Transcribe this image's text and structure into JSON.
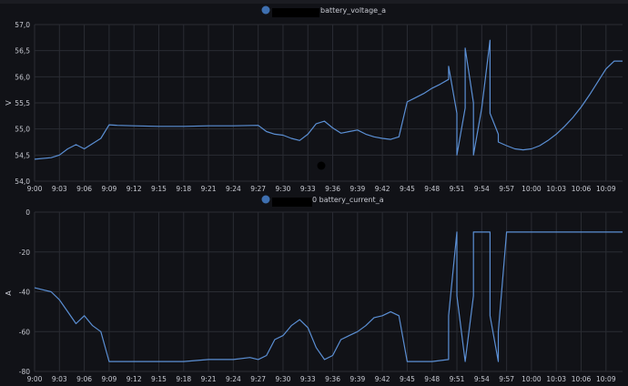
{
  "colors": {
    "background": "#111217",
    "grid": "#2a2c33",
    "text": "#c7c9d1",
    "series": "#5b8fd4",
    "legend_dot": "#3e6fb0",
    "redaction": "#000000"
  },
  "chart_data": [
    {
      "type": "line",
      "legend": {
        "prefix": "",
        "suffix": "battery_voltage_a",
        "placement": "top-center"
      },
      "ylabel": "V",
      "ylim": [
        54.0,
        57.0
      ],
      "y_ticks": [
        "54,0",
        "54,5",
        "55,0",
        "55,5",
        "56,0",
        "56,5",
        "57,0"
      ],
      "y_tick_values": [
        54.0,
        54.5,
        55.0,
        55.5,
        56.0,
        56.5,
        57.0
      ],
      "x_ticks": [
        "9:00",
        "9:03",
        "9:06",
        "9:09",
        "9:12",
        "9:15",
        "9:18",
        "9:21",
        "9:24",
        "9:27",
        "9:30",
        "9:33",
        "9:36",
        "9:39",
        "9:42",
        "9:45",
        "9:48",
        "9:51",
        "9:54",
        "9:57",
        "10:00",
        "10:03",
        "10:06",
        "10:09"
      ],
      "grid": true,
      "series": [
        {
          "x": [
            "9:00",
            "9:02",
            "9:03",
            "9:04",
            "9:05",
            "9:06",
            "9:07",
            "9:08",
            "9:09",
            "9:10",
            "9:12",
            "9:15",
            "9:18",
            "9:21",
            "9:24",
            "9:27",
            "9:28",
            "9:29",
            "9:30",
            "9:31",
            "9:32",
            "9:33",
            "9:34",
            "9:35",
            "9:36",
            "9:37",
            "9:38",
            "9:39",
            "9:40",
            "9:41",
            "9:42",
            "9:43",
            "9:44",
            "9:45",
            "9:46",
            "9:47",
            "9:48",
            "9:49",
            "9:50",
            "9:50",
            "9:51",
            "9:51",
            "9:52",
            "9:52",
            "9:53",
            "9:53",
            "9:54",
            "9:55",
            "9:55",
            "9:56",
            "9:56",
            "9:57",
            "9:58",
            "9:59",
            "10:00",
            "10:01",
            "10:02",
            "10:03",
            "10:04",
            "10:05",
            "10:06",
            "10:07",
            "10:08",
            "10:09",
            "10:10",
            "10:11"
          ],
          "y": [
            54.42,
            54.45,
            54.5,
            54.62,
            54.7,
            54.62,
            54.72,
            54.82,
            55.08,
            55.07,
            55.06,
            55.05,
            55.05,
            55.06,
            55.06,
            55.07,
            54.95,
            54.9,
            54.88,
            54.82,
            54.78,
            54.9,
            55.1,
            55.15,
            55.02,
            54.92,
            54.95,
            54.98,
            54.9,
            54.85,
            54.82,
            54.8,
            54.85,
            55.52,
            55.6,
            55.68,
            55.78,
            55.86,
            55.95,
            56.2,
            55.3,
            54.5,
            55.4,
            56.55,
            55.5,
            54.5,
            55.4,
            56.7,
            55.3,
            54.9,
            54.75,
            54.68,
            54.62,
            54.6,
            54.62,
            54.68,
            54.78,
            54.9,
            55.05,
            55.22,
            55.42,
            55.65,
            55.9,
            56.15,
            56.3,
            56.3
          ]
        }
      ],
      "annotations": []
    },
    {
      "type": "line",
      "legend": {
        "prefix": "",
        "suffix": "0 battery_current_a",
        "placement": "top-center"
      },
      "ylabel": "A",
      "ylim": [
        -80,
        0
      ],
      "y_ticks": [
        "-80",
        "-60",
        "-40",
        "-20",
        "0"
      ],
      "y_tick_values": [
        -80,
        -60,
        -40,
        -20,
        0
      ],
      "x_ticks": [
        "9:00",
        "9:03",
        "9:06",
        "9:09",
        "9:12",
        "9:15",
        "9:18",
        "9:21",
        "9:24",
        "9:27",
        "9:30",
        "9:33",
        "9:36",
        "9:39",
        "9:42",
        "9:45",
        "9:48",
        "9:51",
        "9:54",
        "9:57",
        "10:00",
        "10:03",
        "10:06",
        "10:09"
      ],
      "grid": true,
      "series": [
        {
          "x": [
            "9:00",
            "9:01",
            "9:02",
            "9:03",
            "9:04",
            "9:05",
            "9:06",
            "9:07",
            "9:08",
            "9:09",
            "9:10",
            "9:12",
            "9:15",
            "9:18",
            "9:21",
            "9:24",
            "9:26",
            "9:27",
            "9:28",
            "9:29",
            "9:30",
            "9:31",
            "9:32",
            "9:33",
            "9:34",
            "9:35",
            "9:36",
            "9:37",
            "9:38",
            "9:39",
            "9:40",
            "9:41",
            "9:42",
            "9:43",
            "9:44",
            "9:45",
            "9:48",
            "9:50",
            "9:50",
            "9:51",
            "9:51",
            "9:52",
            "9:53",
            "9:53",
            "9:54",
            "9:55",
            "9:55",
            "9:56",
            "9:56",
            "9:57",
            "10:00",
            "10:03",
            "10:06",
            "10:09",
            "10:11"
          ],
          "y": [
            -38,
            -39,
            -40,
            -44,
            -50,
            -56,
            -52,
            -57,
            -60,
            -75,
            -75,
            -75,
            -75,
            -75,
            -74,
            -74,
            -73,
            -74,
            -72,
            -64,
            -62,
            -57,
            -54,
            -58,
            -68,
            -74,
            -72,
            -64,
            -62,
            -60,
            -57,
            -53,
            -52,
            -50,
            -52,
            -75,
            -75,
            -74,
            -52,
            -10,
            -42,
            -75,
            -42,
            -10,
            -10,
            -10,
            -52,
            -75,
            -60,
            -10,
            -10,
            -10,
            -10,
            -10,
            -10
          ]
        }
      ],
      "annotations": []
    }
  ]
}
